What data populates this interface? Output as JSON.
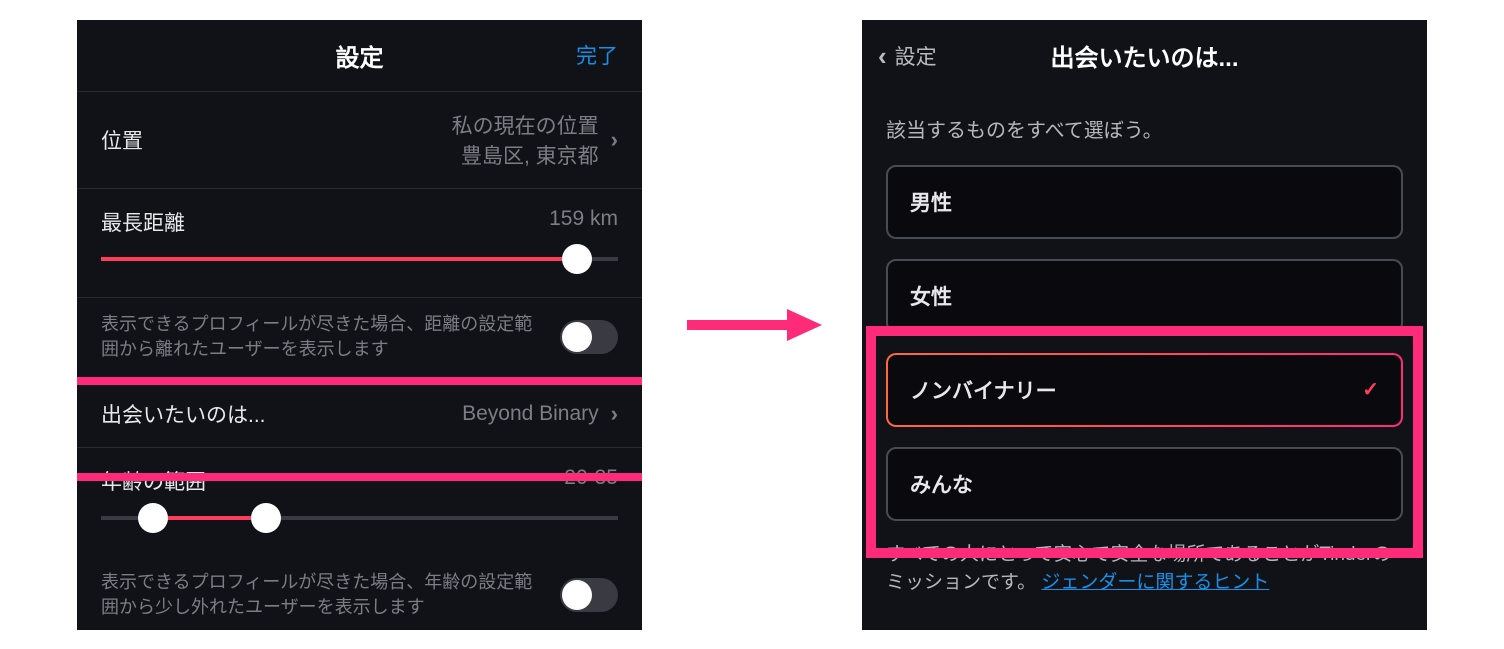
{
  "left": {
    "header": {
      "title": "設定",
      "done": "完了"
    },
    "location": {
      "label": "位置",
      "value1": "私の現在の位置",
      "value2": "豊島区, 東京都"
    },
    "distance": {
      "label": "最長距離",
      "value": "159 km",
      "percent": 92
    },
    "distance_toggle": {
      "text": "表示できるプロフィールが尽きた場合、距離の設定範囲から離れたユーザーを表示します",
      "on": false
    },
    "want_to_meet": {
      "label": "出会いたいのは...",
      "value": "Beyond Binary"
    },
    "age": {
      "label": "年齢の範囲",
      "value": "20-35",
      "min_percent": 10,
      "max_percent": 32
    },
    "age_toggle": {
      "text": "表示できるプロフィールが尽きた場合、年齢の設定範囲から少し外れたユーザーを表示します",
      "on": false
    }
  },
  "right": {
    "header": {
      "back": "設定",
      "title": "出会いたいのは..."
    },
    "subtitle": "該当するものをすべて選ぼう。",
    "options": [
      {
        "label": "男性",
        "selected": false
      },
      {
        "label": "女性",
        "selected": false
      },
      {
        "label": "ノンバイナリー",
        "selected": true
      },
      {
        "label": "みんな",
        "selected": false
      }
    ],
    "footer": {
      "text": "すべての人にとって安心で安全な場所であることがTinderのミッションです。 ",
      "link": "ジェンダーに関するヒント"
    }
  }
}
